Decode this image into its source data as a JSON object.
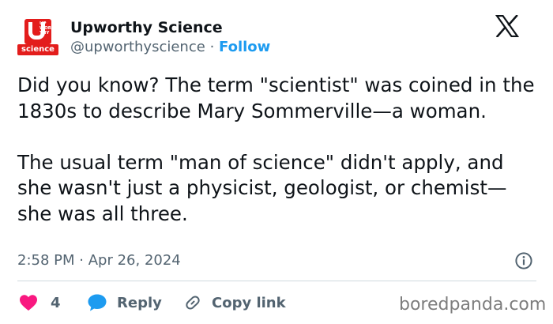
{
  "account": {
    "name": "Upworthy Science",
    "handle": "@upworthyscience",
    "separator": "·",
    "follow_label": "Follow",
    "avatar_text": "UP WOR THY",
    "avatar_label": "science"
  },
  "tweet": {
    "text": "Did you know? The term \"scientist\" was coined in the 1830s to describe Mary Sommerville—a woman.\n\nThe usual term \"man of science\" didn't apply, and she wasn't just a physicist, geologist, or chemist—she was all three.",
    "time": "2:58 PM",
    "date_separator": "·",
    "date": "Apr 26, 2024"
  },
  "actions": {
    "like_count": "4",
    "reply_label": "Reply",
    "copy_label": "Copy link"
  },
  "watermark": "boredpanda.com",
  "colors": {
    "accent": "#1d9bf0",
    "like": "#f91880",
    "brand": "#e31d1c",
    "muted": "#536471"
  },
  "icons": [
    "x-logo-icon",
    "info-icon",
    "heart-icon",
    "reply-bubble-icon",
    "link-icon"
  ]
}
